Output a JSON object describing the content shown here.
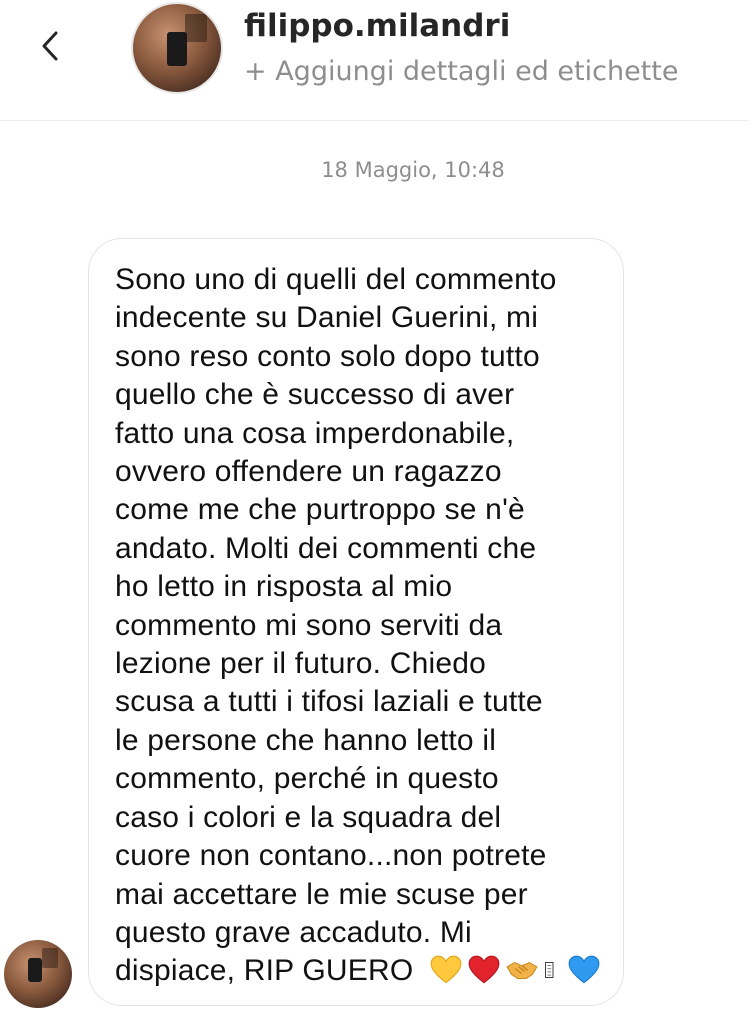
{
  "header": {
    "back_icon": "chevron-left-icon",
    "username": "filippo.milandri",
    "subtitle": "+ Aggiungi dettagli ed etichette"
  },
  "thread": {
    "timestamp": "18 Maggio, 10:48"
  },
  "message": {
    "lines": [
      "Sono uno di quelli del commento",
      "indecente su Daniel Guerini, mi",
      "sono reso conto solo dopo tutto",
      "quello che è successo di aver",
      "fatto una cosa imperdonabile,",
      "ovvero offendere un ragazzo",
      "come me che purtroppo se n'è",
      "andato. Molti dei commenti che",
      "ho letto in risposta al mio",
      "commento mi sono serviti da",
      "lezione per il futuro. Chiedo",
      "scusa a tutti i tifosi laziali e tutte",
      "le persone che hanno letto il",
      "commento, perché in questo",
      "caso i colori e la squadra del",
      "cuore non contano...non potrete",
      "mai accettare le mie scuse per",
      "questo grave accaduto. Mi"
    ],
    "last_line": "dispiace, RIP GUERO",
    "emojis": [
      "yellow-heart-icon",
      "red-heart-icon",
      "handshake-icon",
      "missing-glyph-icon",
      "blue-heart-icon"
    ]
  },
  "colors": {
    "yellow_heart": "#FFC83D",
    "red_heart": "#E2232E",
    "blue_heart": "#2F9BF0",
    "handshake": "#F2B24A"
  }
}
